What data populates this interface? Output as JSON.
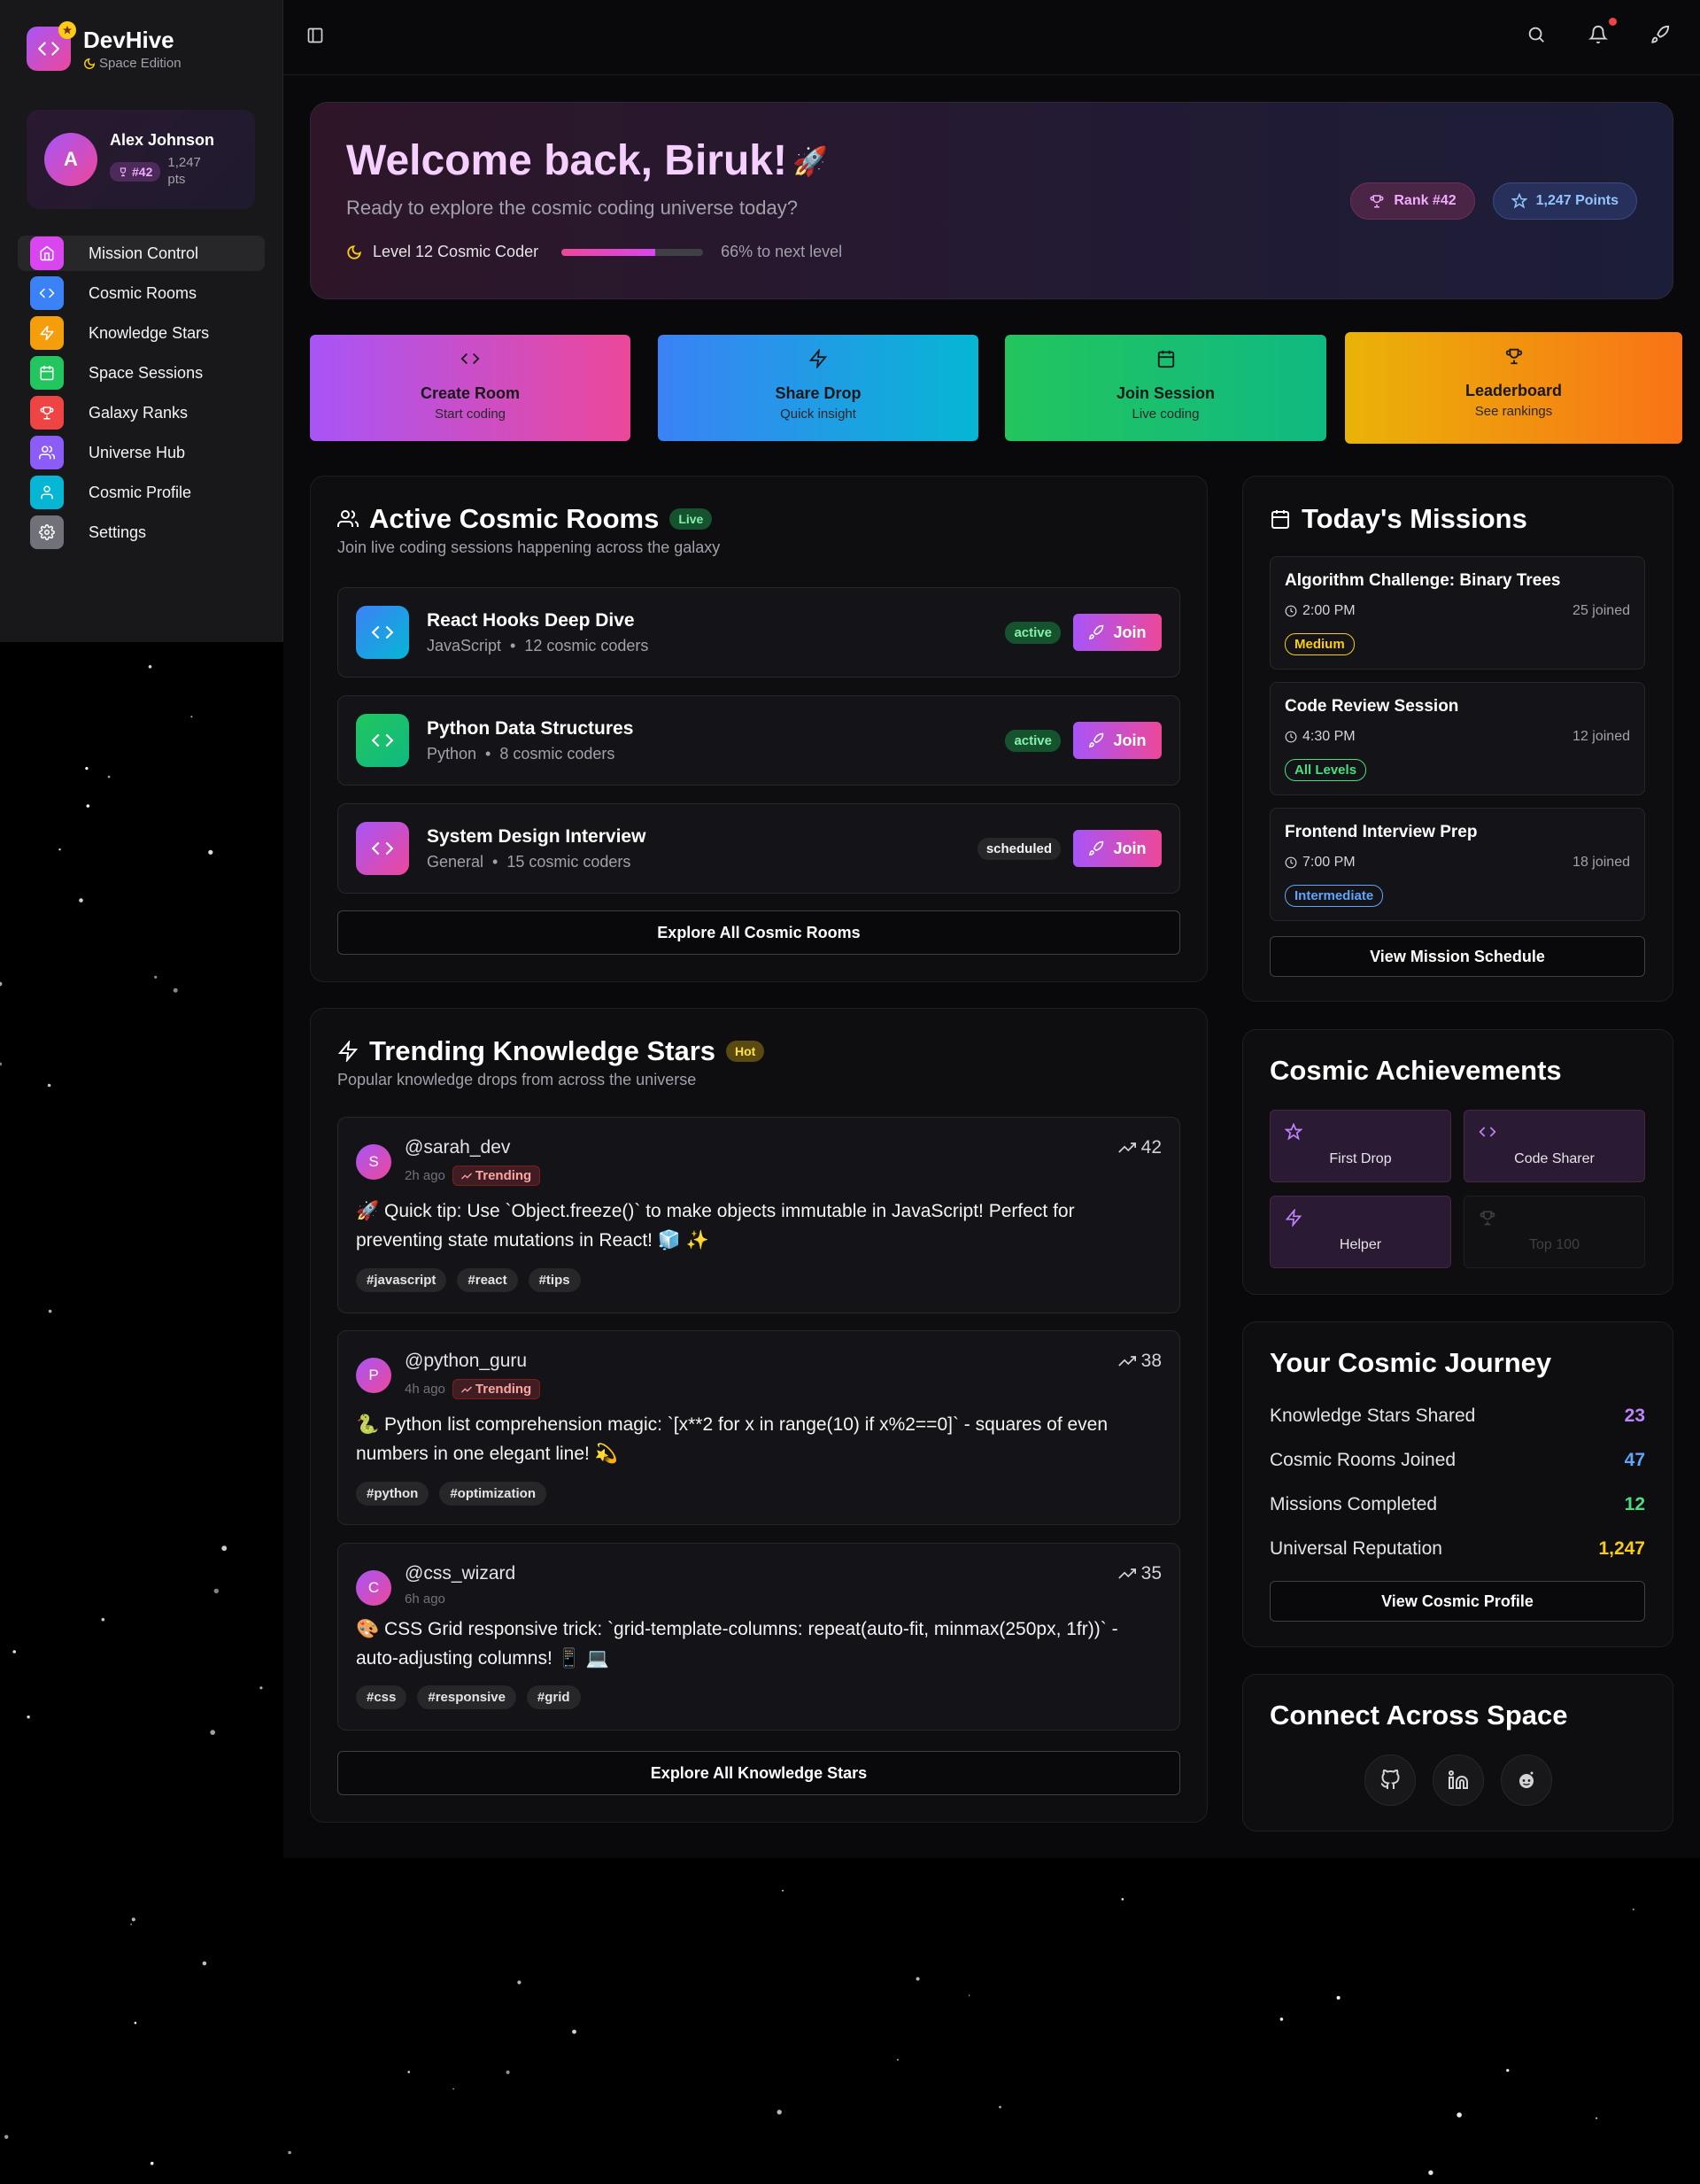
{
  "colors": {
    "accent_purple": "#a855f7",
    "accent_pink": "#ec4899",
    "bg": "#09090b",
    "sidebar_bg": "#18181b"
  },
  "brand": {
    "name": "DevHive",
    "subtitle": "Space Edition",
    "icon": "code-icon"
  },
  "user": {
    "initial": "A",
    "name": "Alex Johnson",
    "rank": "#42",
    "points": "1,247 pts"
  },
  "nav": [
    {
      "label": "Mission Control",
      "icon": "home-icon",
      "color": "#d946ef",
      "active": true
    },
    {
      "label": "Cosmic Rooms",
      "icon": "code-icon",
      "color": "#3b82f6"
    },
    {
      "label": "Knowledge Stars",
      "icon": "zap-icon",
      "color": "#f59e0b"
    },
    {
      "label": "Space Sessions",
      "icon": "calendar-icon",
      "color": "#22c55e"
    },
    {
      "label": "Galaxy Ranks",
      "icon": "trophy-icon",
      "color": "#ef4444"
    },
    {
      "label": "Universe Hub",
      "icon": "users-icon",
      "color": "#8b5cf6"
    },
    {
      "label": "Cosmic Profile",
      "icon": "user-icon",
      "color": "#06b6d4"
    },
    {
      "label": "Settings",
      "icon": "gear-icon",
      "color": "#71717a"
    }
  ],
  "hero": {
    "title": "Welcome back, Biruk!",
    "subtitle": "Ready to explore the cosmic coding universe today?",
    "level": "Level 12 Cosmic Coder",
    "progress": 0.66,
    "next": "66% to next level",
    "rank_badge": "Rank #42",
    "points_badge": "1,247 Points"
  },
  "quick_actions": [
    {
      "title": "Create Room",
      "sub": "Start coding",
      "icon": "code-icon"
    },
    {
      "title": "Share Drop",
      "sub": "Quick insight",
      "icon": "zap-icon"
    },
    {
      "title": "Join Session",
      "sub": "Live coding",
      "icon": "calendar-icon"
    },
    {
      "title": "Leaderboard",
      "sub": "See rankings",
      "icon": "trophy-icon"
    }
  ],
  "rooms_panel": {
    "title": "Active Cosmic Rooms",
    "tag": "Live",
    "subtitle": "Join live coding sessions happening across the galaxy",
    "rooms": [
      {
        "name": "React Hooks Deep Dive",
        "lang": "JavaScript",
        "coders": "12 cosmic coders",
        "status": "active",
        "join": "Join"
      },
      {
        "name": "Python Data Structures",
        "lang": "Python",
        "coders": "8 cosmic coders",
        "status": "active",
        "join": "Join"
      },
      {
        "name": "System Design Interview",
        "lang": "General",
        "coders": "15 cosmic coders",
        "status": "scheduled",
        "join": "Join"
      }
    ],
    "explore": "Explore All Cosmic Rooms"
  },
  "stars_panel": {
    "title": "Trending Knowledge Stars",
    "tag": "Hot",
    "subtitle": "Popular knowledge drops from across the universe",
    "trending_label": "Trending",
    "posts": [
      {
        "initial": "S",
        "user": "@sarah_dev",
        "time": "2h ago",
        "trending": true,
        "score": "42",
        "body": "🚀 Quick tip: Use `Object.freeze()` to make objects immutable in JavaScript! Perfect for preventing state mutations in React! 🧊 ✨",
        "tags": [
          "#javascript",
          "#react",
          "#tips"
        ]
      },
      {
        "initial": "P",
        "user": "@python_guru",
        "time": "4h ago",
        "trending": true,
        "score": "38",
        "body": "🐍 Python list comprehension magic: `[x**2 for x in range(10) if x%2==0]` - squares of even numbers in one elegant line! 💫",
        "tags": [
          "#python",
          "#optimization"
        ]
      },
      {
        "initial": "C",
        "user": "@css_wizard",
        "time": "6h ago",
        "trending": false,
        "score": "35",
        "body": "🎨 CSS Grid responsive trick: `grid-template-columns: repeat(auto-fit, minmax(250px, 1fr))` - auto-adjusting columns! 📱 💻",
        "tags": [
          "#css",
          "#responsive",
          "#grid"
        ]
      }
    ],
    "explore": "Explore All Knowledge Stars"
  },
  "missions_panel": {
    "title": "Today's Missions",
    "missions": [
      {
        "title": "Algorithm Challenge: Binary Trees",
        "time": "2:00 PM",
        "joined": "25 joined",
        "level": "Medium",
        "level_color": "#facc15"
      },
      {
        "title": "Code Review Session",
        "time": "4:30 PM",
        "joined": "12 joined",
        "level": "All Levels",
        "level_color": "#4ade80"
      },
      {
        "title": "Frontend Interview Prep",
        "time": "7:00 PM",
        "joined": "18 joined",
        "level": "Intermediate",
        "level_color": "#60a5fa"
      }
    ],
    "button": "View Mission Schedule"
  },
  "achievements_panel": {
    "title": "Cosmic Achievements",
    "items": [
      {
        "label": "First Drop",
        "icon": "star-icon",
        "unlocked": true
      },
      {
        "label": "Code Sharer",
        "icon": "code-icon",
        "unlocked": true
      },
      {
        "label": "Helper",
        "icon": "zap-icon",
        "unlocked": true
      },
      {
        "label": "Top 100",
        "icon": "trophy-icon",
        "unlocked": false
      }
    ]
  },
  "journey_panel": {
    "title": "Your Cosmic Journey",
    "stats": [
      {
        "label": "Knowledge Stars Shared",
        "value": "23",
        "color": "#c084fc"
      },
      {
        "label": "Cosmic Rooms Joined",
        "value": "47",
        "color": "#60a5fa"
      },
      {
        "label": "Missions Completed",
        "value": "12",
        "color": "#4ade80"
      },
      {
        "label": "Universal Reputation",
        "value": "1,247",
        "color": "#facc15"
      }
    ],
    "button": "View Cosmic Profile"
  },
  "connect_panel": {
    "title": "Connect Across Space",
    "links": [
      "github-icon",
      "linkedin-icon",
      "reddit-icon"
    ]
  }
}
